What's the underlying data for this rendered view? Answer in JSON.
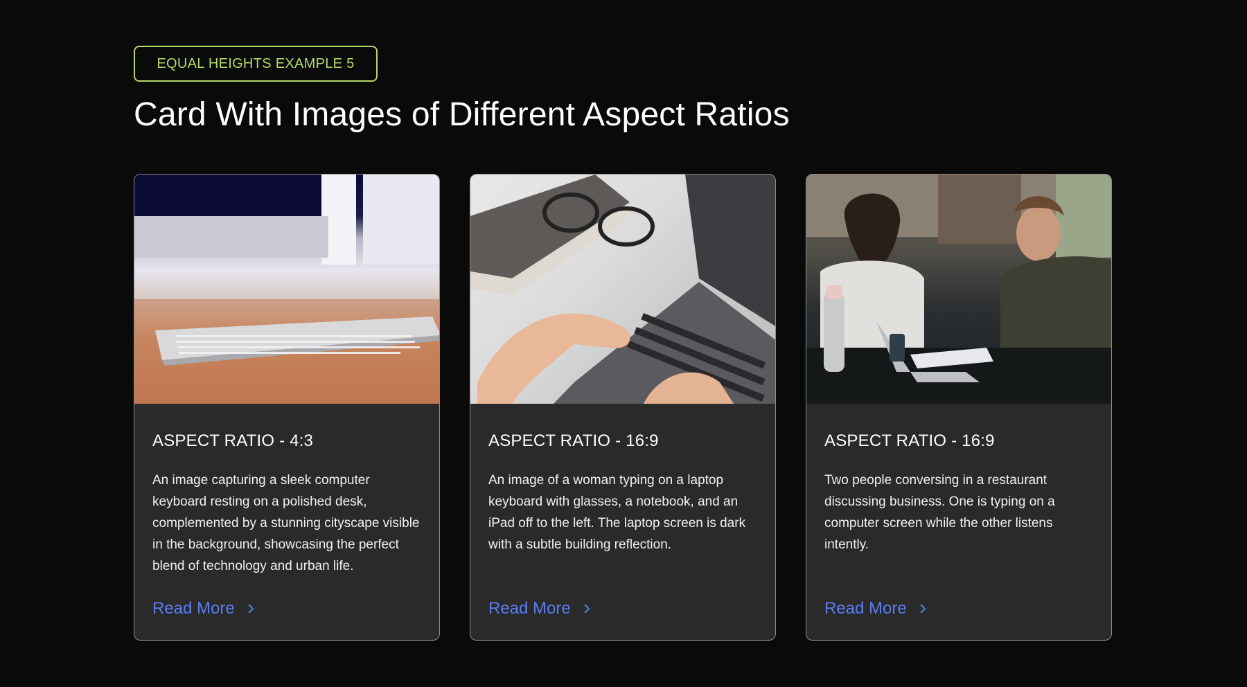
{
  "eyebrow": "EQUAL HEIGHTS EXAMPLE 5",
  "heading": "Card With Images of Different Aspect Ratios",
  "colors": {
    "accent_green": "#b5d86a",
    "link_blue": "#5b7cf0",
    "card_bg": "#2a2a2a",
    "page_bg": "#0a0a0a"
  },
  "cards": [
    {
      "title": "ASPECT RATIO - 4:3",
      "text": "An image capturing a sleek computer keyboard resting on a polished desk, complemented by a stunning cityscape visible in the background, showcasing the perfect blend of technology and urban life.",
      "link": "Read More",
      "icon": "chevron-right-icon"
    },
    {
      "title": "ASPECT RATIO - 16:9",
      "text": "An image of a woman typing on a laptop keyboard with glasses, a notebook, and an iPad off to the left. The laptop screen is dark with a subtle building reflection.",
      "link": "Read More",
      "icon": "chevron-right-icon"
    },
    {
      "title": "ASPECT RATIO - 16:9",
      "text": "Two people conversing in a restaurant discussing business. One is typing on a computer screen while the other listens intently.",
      "link": "Read More",
      "icon": "chevron-right-icon"
    }
  ]
}
